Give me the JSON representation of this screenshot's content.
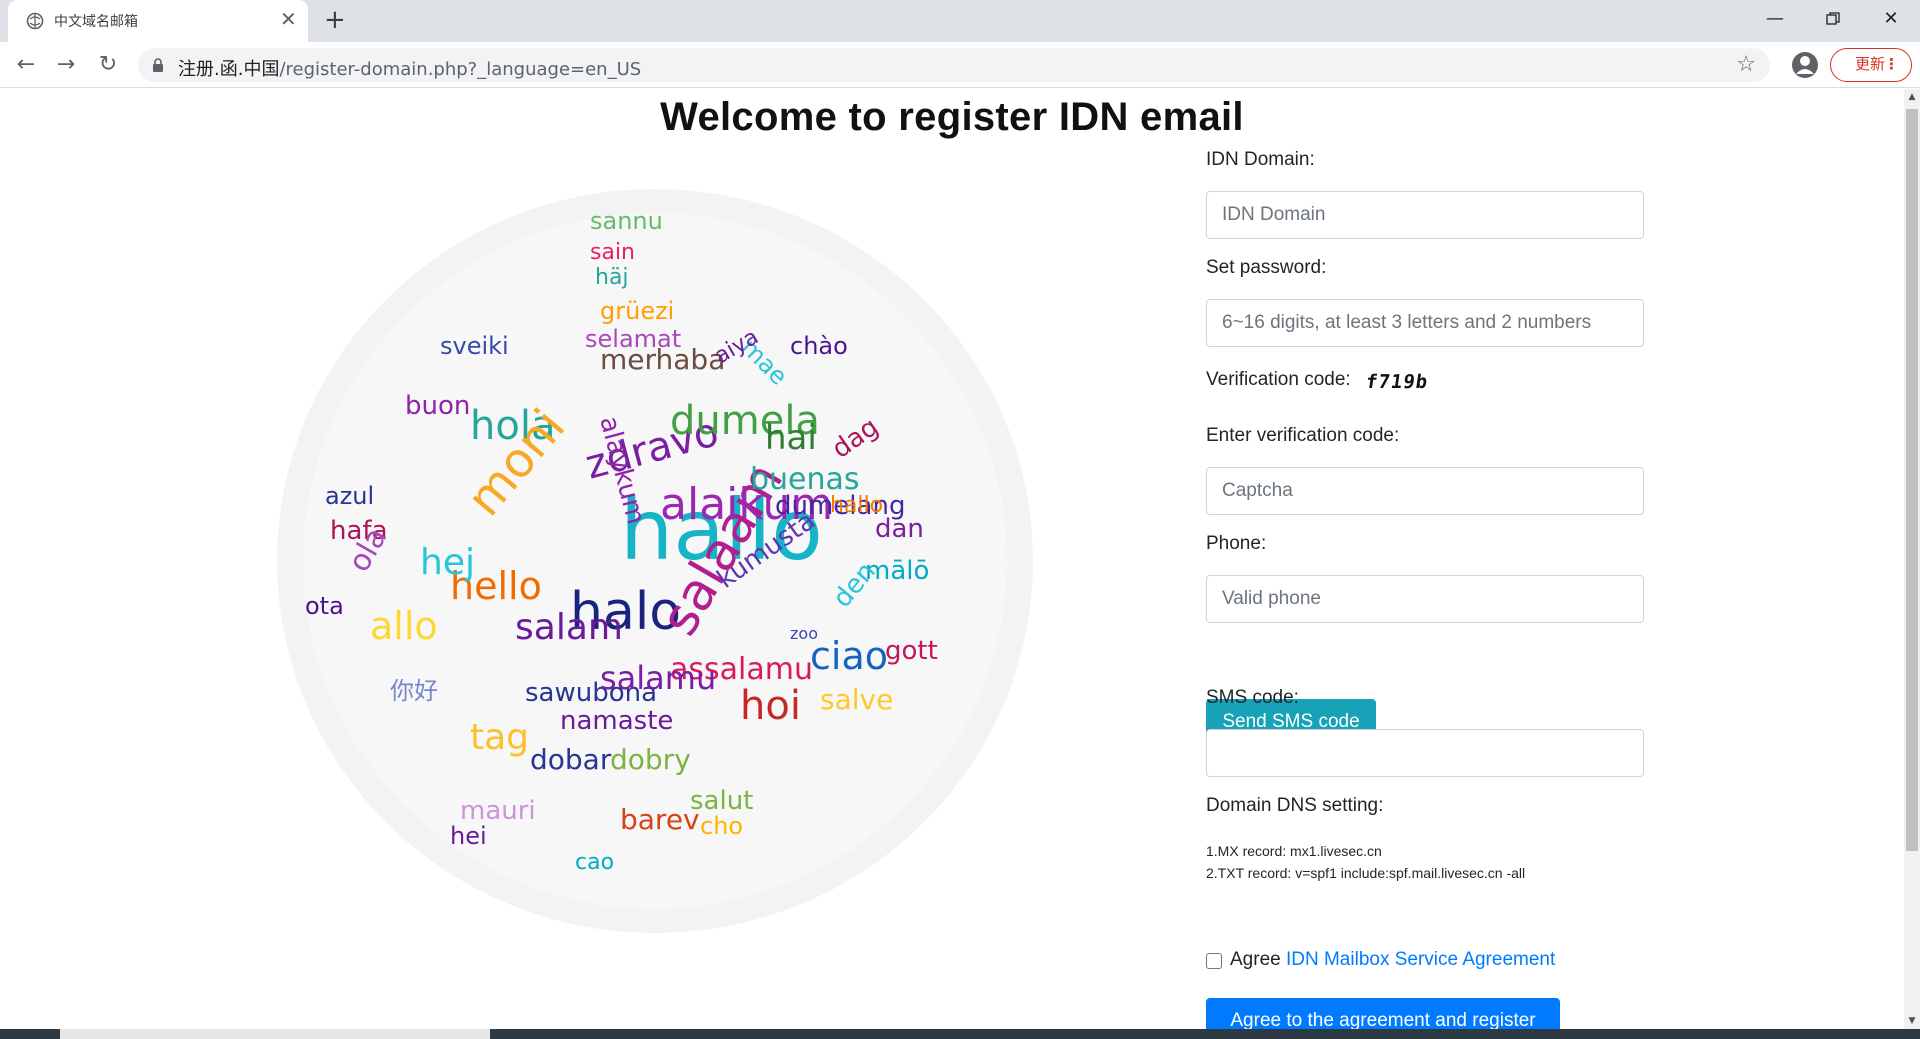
{
  "browser": {
    "tab_title": "中文域名邮箱",
    "url_host": "注册.函.中国",
    "url_path": "/register-domain.php?_language=en_US",
    "update_label": "更新",
    "icons": [
      "page-icon",
      "close-icon",
      "plus-icon",
      "minimize-icon",
      "maximize-icon",
      "close-window-icon",
      "back-icon",
      "forward-icon",
      "reload-icon",
      "lock-icon",
      "star-icon",
      "profile-icon",
      "kebab-menu-icon"
    ]
  },
  "page": {
    "title": "Welcome to register IDN email"
  },
  "form": {
    "domain_label": "IDN Domain:",
    "domain_placeholder": "IDN Domain",
    "password_label": "Set password:",
    "password_placeholder": "6~16 digits, at least 3 letters and 2 numbers",
    "verification_label": "Verification code:",
    "verification_code": "f719b",
    "enter_code_label": "Enter verification code:",
    "captcha_placeholder": "Captcha",
    "phone_label": "Phone:",
    "phone_placeholder": "Valid phone",
    "send_sms_label": "Send SMS code",
    "sms_label": "SMS code:",
    "sms_value": "",
    "dns_label": "Domain DNS setting:",
    "dns_mx": "1.MX record: mx1.livesec.cn",
    "dns_txt": "2.TXT record: v=spf1 include:spf.mail.livesec.cn -all",
    "agree_prefix": "Agree",
    "agree_link": "IDN Mailbox Service Agreement",
    "register_label": "Agree to the agreement and register",
    "colors": {
      "primary": "#007bff",
      "info": "#17a2b8"
    }
  },
  "word_cloud": {
    "words": [
      {
        "t": "hallo",
        "c": "#17b3c7"
      },
      {
        "t": "halo",
        "c": "#1a237e"
      },
      {
        "t": "salaam",
        "c": "#b01e8f"
      },
      {
        "t": "alaikum",
        "c": "#9c27b0"
      },
      {
        "t": "zdravo",
        "c": "#7b1fa2"
      },
      {
        "t": "dumela",
        "c": "#43a047"
      },
      {
        "t": "hola",
        "c": "#26a69a"
      },
      {
        "t": "moni",
        "c": "#f9a825"
      },
      {
        "t": "hello",
        "c": "#ef6c00"
      },
      {
        "t": "salam",
        "c": "#6a1b9a"
      },
      {
        "t": "allo",
        "c": "#fdd835"
      },
      {
        "t": "hej",
        "c": "#26c6da"
      },
      {
        "t": "ciao",
        "c": "#1565c0"
      },
      {
        "t": "hoi",
        "c": "#c62828"
      },
      {
        "t": "alaykum",
        "c": "#8e24aa"
      },
      {
        "t": "kumusta",
        "c": "#5e35b1"
      },
      {
        "t": "assalamu",
        "c": "#d81b60"
      },
      {
        "t": "sawubona",
        "c": "#283593"
      },
      {
        "t": "namaste",
        "c": "#6a1b9a"
      },
      {
        "t": "tag",
        "c": "#fbc02d"
      },
      {
        "t": "dobar",
        "c": "#283593"
      },
      {
        "t": "dobry",
        "c": "#7cb342"
      },
      {
        "t": "merhaba",
        "c": "#6d4c41"
      },
      {
        "t": "selamat",
        "c": "#ab47bc"
      },
      {
        "t": "grüezi",
        "c": "#ffa000"
      },
      {
        "t": "sveiki",
        "c": "#3949ab"
      },
      {
        "t": "buon",
        "c": "#8e24aa"
      },
      {
        "t": "hai",
        "c": "#2e7d32"
      },
      {
        "t": "buenas",
        "c": "#26a69a"
      },
      {
        "t": "dumelang",
        "c": "#4527a0"
      },
      {
        "t": "hafa",
        "c": "#ad1457"
      },
      {
        "t": "azul",
        "c": "#283593"
      },
      {
        "t": "ola",
        "c": "#ab47bc"
      },
      {
        "t": "ota",
        "c": "#4a148c"
      },
      {
        "t": "salve",
        "c": "#ffca28"
      },
      {
        "t": "gott",
        "c": "#c2185b"
      },
      {
        "t": "mālō",
        "c": "#00acc1"
      },
      {
        "t": "dan",
        "c": "#7b1fa2"
      },
      {
        "t": "hallo",
        "c": "#f57c00"
      },
      {
        "t": "dag",
        "c": "#ad1457"
      },
      {
        "t": "mae",
        "c": "#26c6da"
      },
      {
        "t": "chào",
        "c": "#4a148c"
      },
      {
        "t": "aiya",
        "c": "#6a1b9a"
      },
      {
        "t": "sannu",
        "c": "#66bb6a"
      },
      {
        "t": "sain",
        "c": "#e91e63"
      },
      {
        "t": "häj",
        "c": "#26a69a"
      },
      {
        "t": "barev",
        "c": "#d84315"
      },
      {
        "t": "salut",
        "c": "#7cb342"
      },
      {
        "t": "mauri",
        "c": "#ce93d8"
      },
      {
        "t": "hei",
        "c": "#6a1b9a"
      },
      {
        "t": "cao",
        "c": "#00acc1"
      },
      {
        "t": "cho",
        "c": "#ffb300"
      },
      {
        "t": "den",
        "c": "#26c6da"
      },
      {
        "t": "zoo",
        "c": "#3949ab"
      },
      {
        "t": "salamu",
        "c": "#7b1fa2"
      },
      {
        "t": "你好",
        "c": "#7986cb"
      }
    ]
  }
}
